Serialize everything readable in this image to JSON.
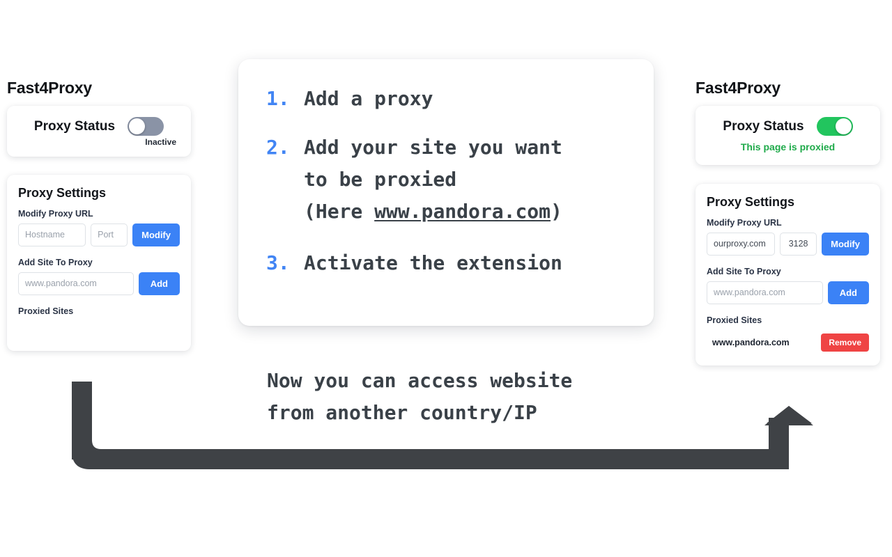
{
  "colors": {
    "accent_blue": "#3b82f6",
    "step_number_blue": "#4285f4",
    "toggle_on_green": "#22c55e",
    "status_text_green": "#1faa4a",
    "toggle_off_gray": "#8a93a6",
    "danger_red": "#ef4444",
    "arrow_dark": "#3f4246",
    "text_dark": "#3a4148",
    "background": "#ffffff"
  },
  "left_panel": {
    "brand": "Fast4Proxy",
    "status_card": {
      "label": "Proxy Status",
      "toggle_state": "off",
      "sub_text": "Inactive"
    },
    "settings_card": {
      "title": "Proxy Settings",
      "modify_label": "Modify Proxy URL",
      "hostname_placeholder": "Hostname",
      "hostname_value": "",
      "port_placeholder": "Port",
      "port_value": "",
      "modify_button": "Modify",
      "add_site_label": "Add Site To Proxy",
      "site_placeholder": "www.pandora.com",
      "site_value": "",
      "add_button": "Add",
      "proxied_sites_label": "Proxied Sites",
      "proxied_sites": []
    }
  },
  "right_panel": {
    "brand": "Fast4Proxy",
    "status_card": {
      "label": "Proxy Status",
      "toggle_state": "on",
      "sub_text": "This page is proxied"
    },
    "settings_card": {
      "title": "Proxy Settings",
      "modify_label": "Modify Proxy URL",
      "hostname_placeholder": "Hostname",
      "hostname_value": "ourproxy.com",
      "port_placeholder": "Port",
      "port_value": "3128",
      "modify_button": "Modify",
      "add_site_label": "Add Site To Proxy",
      "site_placeholder": "www.pandora.com",
      "site_value": "",
      "add_button": "Add",
      "proxied_sites_label": "Proxied Sites",
      "proxied_sites": [
        {
          "name": "www.pandora.com",
          "remove_button": "Remove"
        }
      ]
    }
  },
  "instructions": {
    "steps": [
      {
        "number": "1.",
        "text": "Add a proxy"
      },
      {
        "number": "2.",
        "text_before": "Add your site you want\nto be proxied\n(Here ",
        "link": "www.pandora.com",
        "text_after": ")"
      },
      {
        "number": "3.",
        "text": "Activate the extension"
      }
    ]
  },
  "caption": "Now you can access website\nfrom another country/IP"
}
